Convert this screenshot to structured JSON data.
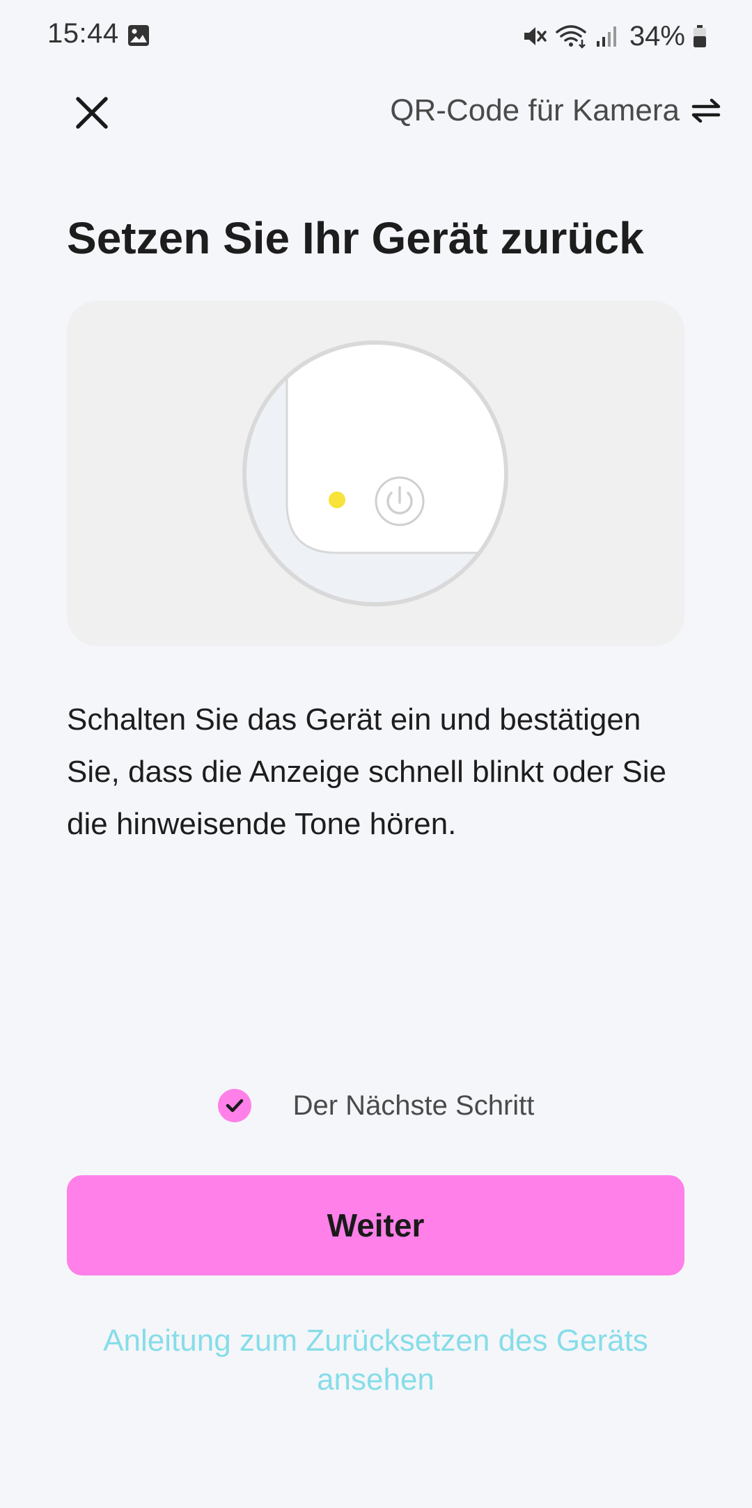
{
  "status_bar": {
    "time": "15:44",
    "battery": "34%",
    "icons": [
      "gallery-icon",
      "mute-icon",
      "wifi-icon",
      "signal-icon",
      "battery-icon"
    ]
  },
  "header": {
    "close_icon": "close-icon",
    "qr_switch_label": "QR-Code für Kamera",
    "switch_icon": "swap-arrows-icon"
  },
  "main": {
    "title": "Setzen Sie Ihr Gerät zurück",
    "illustration_icons": [
      "device-led-icon",
      "power-icon"
    ],
    "instruction": "Schalten Sie das Gerät ein und bestätigen Sie, dass die Anzeige schnell blinkt oder Sie die hinweisende Tone hören."
  },
  "next_step": {
    "checked": true,
    "label": "Der Nächste Schritt"
  },
  "actions": {
    "primary_label": "Weiter",
    "guide_link": "Anleitung zum Zurücksetzen des Geräts ansehen"
  },
  "colors": {
    "accent": "#ff80e8",
    "link": "#86dde8",
    "background": "#f5f6fa",
    "led": "#f7e33a"
  }
}
